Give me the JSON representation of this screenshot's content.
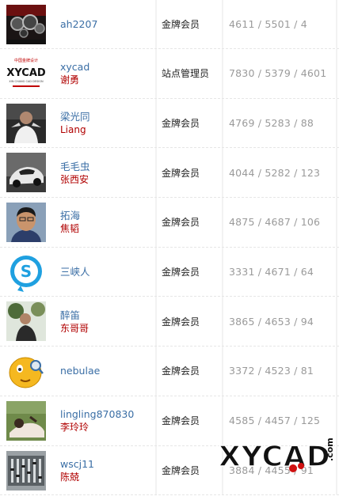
{
  "members": [
    {
      "username": "ah2207",
      "realname": "",
      "level": "金牌会员",
      "stats": "4611 / 5501 / 4",
      "avatar": "avatar-dark-mechanical"
    },
    {
      "username": "xycad",
      "realname": "谢勇",
      "level": "站点管理员",
      "stats": "7830 / 5379 / 4601",
      "avatar": "avatar-xycad-logo"
    },
    {
      "username": "梁光同",
      "realname": "Liang",
      "level": "金牌会员",
      "stats": "4769 / 5283 / 88",
      "avatar": "avatar-person-dark"
    },
    {
      "username": "毛毛虫",
      "realname": "张西安",
      "level": "金牌会员",
      "stats": "4044 / 5282 / 123",
      "avatar": "avatar-sports-car"
    },
    {
      "username": "拓海",
      "realname": "焦韬",
      "level": "金牌会员",
      "stats": "4875 / 4687 / 106",
      "avatar": "avatar-portrait-man"
    },
    {
      "username": "三峡人",
      "realname": "",
      "level": "金牌会员",
      "stats": "3331 / 4671 / 64",
      "avatar": "avatar-skype"
    },
    {
      "username": "醉笛",
      "realname": "东哥哥",
      "level": "金牌会员",
      "stats": "3865 / 4653 / 94",
      "avatar": "avatar-person-tree"
    },
    {
      "username": "nebulae",
      "realname": "",
      "level": "金牌会员",
      "stats": "3372 / 4523 / 81",
      "avatar": "avatar-emoji-face"
    },
    {
      "username": "lingling870830",
      "realname": "李玲玲",
      "level": "金牌会员",
      "stats": "4585 / 4457 / 125",
      "avatar": "avatar-person-grass"
    },
    {
      "username": "wscj11",
      "realname": "陈兢",
      "level": "金牌会员",
      "stats": "3884 / 4455 / 91",
      "avatar": "avatar-mixer-console"
    }
  ],
  "xycad_avatar_text": {
    "top": "中国金牌设计",
    "logo": "XYCAD",
    "sub": "XIN CHANG CAD DESIGN"
  },
  "watermark": {
    "text": "XYCAD",
    ".com": ".com"
  }
}
